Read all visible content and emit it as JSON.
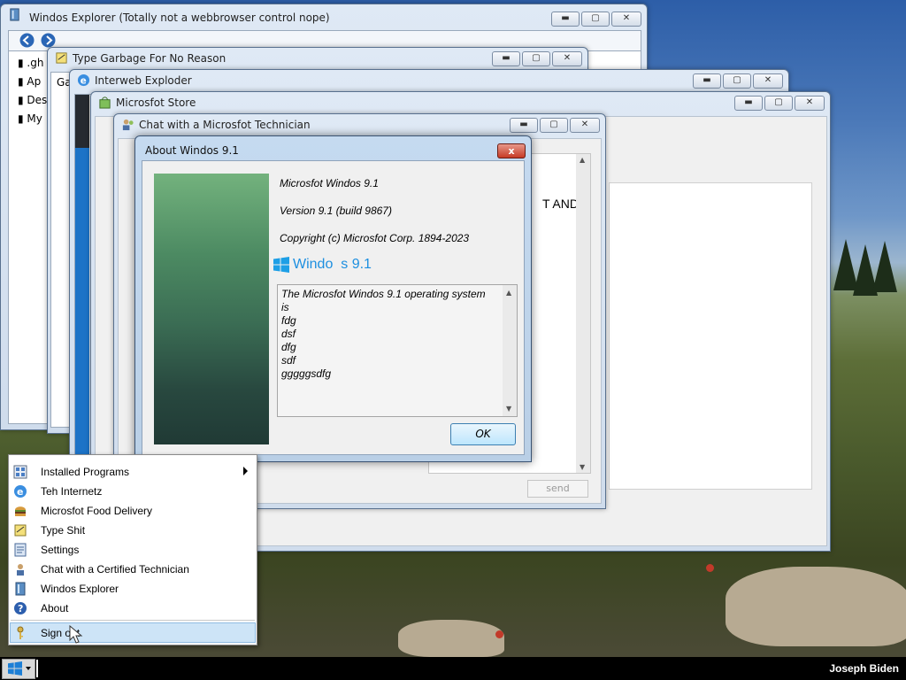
{
  "windows": {
    "explorer": {
      "title": "Windos Explorer (Totally not a webbrowser control nope)",
      "tree_items": [
        ".gh",
        "Ap",
        "Des",
        "My"
      ]
    },
    "typing": {
      "title": "Type Garbage For No Reason",
      "body_text": "Ga"
    },
    "browser": {
      "title": "Interweb Exploder"
    },
    "store": {
      "title": "Microsfot Store"
    },
    "chat": {
      "title": "Chat with a Microsfot Technician",
      "partial_text": "T AND",
      "send_label": "send"
    }
  },
  "about": {
    "title": "About Windos 9.1",
    "product": "Microsfot Windos 9.1",
    "version": "Version 9.1 (build 9867)",
    "copyright": "Copyright (c) Microsfot Corp. 1894-2023",
    "logo_text": "Windo  s 9.1",
    "description_lines": [
      "The Microsfot Windos 9.1 operating system",
      "is",
      "fdg",
      "dsf",
      "dfg",
      "sdf",
      "gggggsdfg"
    ],
    "ok_label": "OK",
    "close_label": "x"
  },
  "start_menu": {
    "items": [
      {
        "label": "Installed Programs",
        "icon": "programs-grid-icon",
        "submenu": true
      },
      {
        "label": "Teh Internetz",
        "icon": "internet-explorer-icon"
      },
      {
        "label": "Microsfot Food Delivery",
        "icon": "burger-icon"
      },
      {
        "label": "Type Shit",
        "icon": "notepad-icon"
      },
      {
        "label": "Settings",
        "icon": "settings-icon"
      },
      {
        "label": "Chat with a Certified Technician",
        "icon": "technician-icon"
      },
      {
        "label": "Windos Explorer",
        "icon": "explorer-icon"
      },
      {
        "label": "About",
        "icon": "help-icon"
      }
    ],
    "sign_out": {
      "label": "Sign out",
      "icon": "key-icon"
    }
  },
  "taskbar": {
    "user_name": "Joseph Biden",
    "start_icon": "windows-logo-icon"
  },
  "window_buttons": {
    "minimize": "▬",
    "maximize": "▢",
    "close": "✕"
  },
  "colors": {
    "accent_blue": "#1c73c7",
    "about_close_red": "#c63a25",
    "taskbar": "#000000"
  }
}
